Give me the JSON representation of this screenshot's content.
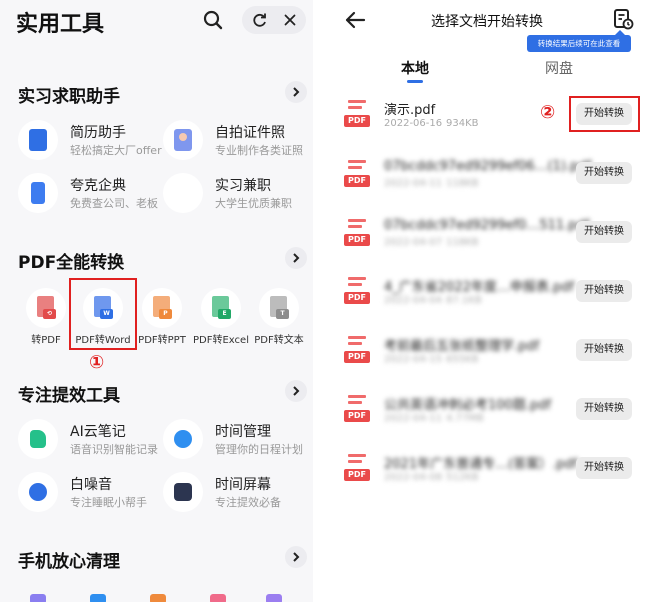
{
  "left": {
    "app_title": "实用工具",
    "sections": [
      {
        "title": "实习求职助手",
        "items": [
          {
            "title": "简历助手",
            "subtitle": "轻松搞定大厂offer",
            "color": "#2f6fe4"
          },
          {
            "title": "自拍证件照",
            "subtitle": "专业制作各类证照",
            "color": "#6a8bea"
          },
          {
            "title": "夸克企典",
            "subtitle": "免费查公司、老板",
            "color": "#3d7cf0"
          },
          {
            "title": "实习兼职",
            "subtitle": "大学生优质兼职",
            "color": "#ffffff"
          }
        ]
      },
      {
        "title": "PDF全能转换",
        "items": [
          {
            "label": "转PDF",
            "tag": "",
            "color": "#e24a4a"
          },
          {
            "label": "PDF转Word",
            "tag": "W",
            "color": "#2f6fe4"
          },
          {
            "label": "PDF转PPT",
            "tag": "P",
            "color": "#ef8a3c"
          },
          {
            "label": "PDF转Excel",
            "tag": "E",
            "color": "#22a867"
          },
          {
            "label": "PDF转文本",
            "tag": "T",
            "color": "#8d8d8d"
          }
        ]
      },
      {
        "title": "专注提效工具",
        "items": [
          {
            "title": "AI云笔记",
            "subtitle": "语音识别智能记录",
            "color": "#25c08a"
          },
          {
            "title": "时间管理",
            "subtitle": "管理你的日程计划",
            "color": "#2f8ff0"
          },
          {
            "title": "白噪音",
            "subtitle": "专注睡眠小帮手",
            "color": "#2f6fe4"
          },
          {
            "title": "时间屏幕",
            "subtitle": "专注提效必备",
            "color": "#2c3550"
          }
        ]
      },
      {
        "title": "手机放心清理"
      }
    ],
    "annotation": "①"
  },
  "right": {
    "header_title": "选择文档开始转换",
    "tooltip": "转换结果后续可在此查看",
    "tabs": [
      {
        "label": "本地",
        "active": true
      },
      {
        "label": "网盘",
        "active": false
      }
    ],
    "annotation": "②",
    "button_label": "开始转换",
    "files": [
      {
        "name": "演示.pdf",
        "date": "2022-06-16",
        "size": "934KB",
        "blurred": false
      },
      {
        "name": "07bcddc97ed9299ef06…(1).pdf",
        "date": "2022-04-11",
        "size": "118KB",
        "blurred": true
      },
      {
        "name": "07bcddc97ed9299ef0…511.pdf",
        "date": "2022-04-07",
        "size": "118KB",
        "blurred": true
      },
      {
        "name": "4_广东省2022年度…申报表.pdf",
        "date": "2022-04-04",
        "size": "87.1KB",
        "blurred": true
      },
      {
        "name": "考前最后五张纸整理学.pdf",
        "date": "2022-04-15",
        "size": "655KB",
        "blurred": true
      },
      {
        "name": "公共英语冲刺必考100题.pdf",
        "date": "2022-04-11",
        "size": "4.77MB",
        "blurred": true
      },
      {
        "name": "2021年广东普通专…(答案）.pdf",
        "date": "2022-04-08",
        "size": "512KB",
        "blurred": true
      }
    ]
  }
}
